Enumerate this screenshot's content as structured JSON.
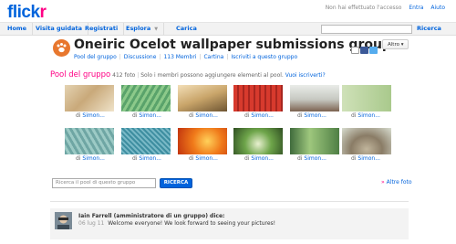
{
  "header": {
    "logo_part1": "flick",
    "logo_part2": "r",
    "signed_out_text": "Non hai effettuato l'accesso",
    "signin_link": "Entra",
    "help_link": "Aiuto"
  },
  "nav": {
    "items": [
      "Home",
      "Visita guidata",
      "Registrati",
      "Esplora",
      "Carica"
    ],
    "search_label": "Ricerca"
  },
  "group": {
    "title": "Oneiric Ocelot wallpaper submissions group",
    "subnav": [
      "Pool del gruppo",
      "Discussione",
      "113 Membri",
      "Cartina",
      "Iscriviti a questo gruppo"
    ],
    "altro_label": "Altro"
  },
  "pool": {
    "title": "Pool del gruppo",
    "count": "412 foto",
    "note": "Solo i membri possono aggiungere elementi al pool.",
    "join_link": "Vuoi iscriverti?",
    "search_placeholder": "Ricerca il pool di questo gruppo",
    "search_button": "RICERCA",
    "more_link": "Altre foto",
    "photos": [
      {
        "prefix": "di",
        "author": "Simon...",
        "thumb": "tan-grass-photo"
      },
      {
        "prefix": "di",
        "author": "Simon...",
        "thumb": "green-leaf-photo"
      },
      {
        "prefix": "di",
        "author": "Simon...",
        "thumb": "curved-architecture-photo"
      },
      {
        "prefix": "di",
        "author": "Simon...",
        "thumb": "red-grid-photo"
      },
      {
        "prefix": "di",
        "author": "Simon...",
        "thumb": "pagoda-photo"
      },
      {
        "prefix": "di",
        "author": "Simon...",
        "thumb": "pale-green-photo"
      },
      {
        "prefix": "di",
        "author": "Simon...",
        "thumb": "teal-leaf-photo"
      },
      {
        "prefix": "di",
        "author": "Simon...",
        "thumb": "blue-texture-photo"
      },
      {
        "prefix": "di",
        "author": "Simon...",
        "thumb": "orange-flame-photo"
      },
      {
        "prefix": "di",
        "author": "Simon...",
        "thumb": "green-sprout-photo"
      },
      {
        "prefix": "di",
        "author": "Simon...",
        "thumb": "green-stem-photo"
      },
      {
        "prefix": "di",
        "author": "Simon...",
        "thumb": "hedgehog-photo"
      }
    ]
  },
  "discussion": {
    "author": "Iain Farrell (amministratore di un gruppo) dice:",
    "date": "06 lug 11",
    "message": "Welcome everyone! We look forward to seeing your pictures!"
  },
  "colors": {
    "flickr_blue": "#0063dc",
    "flickr_pink": "#ff0084"
  }
}
